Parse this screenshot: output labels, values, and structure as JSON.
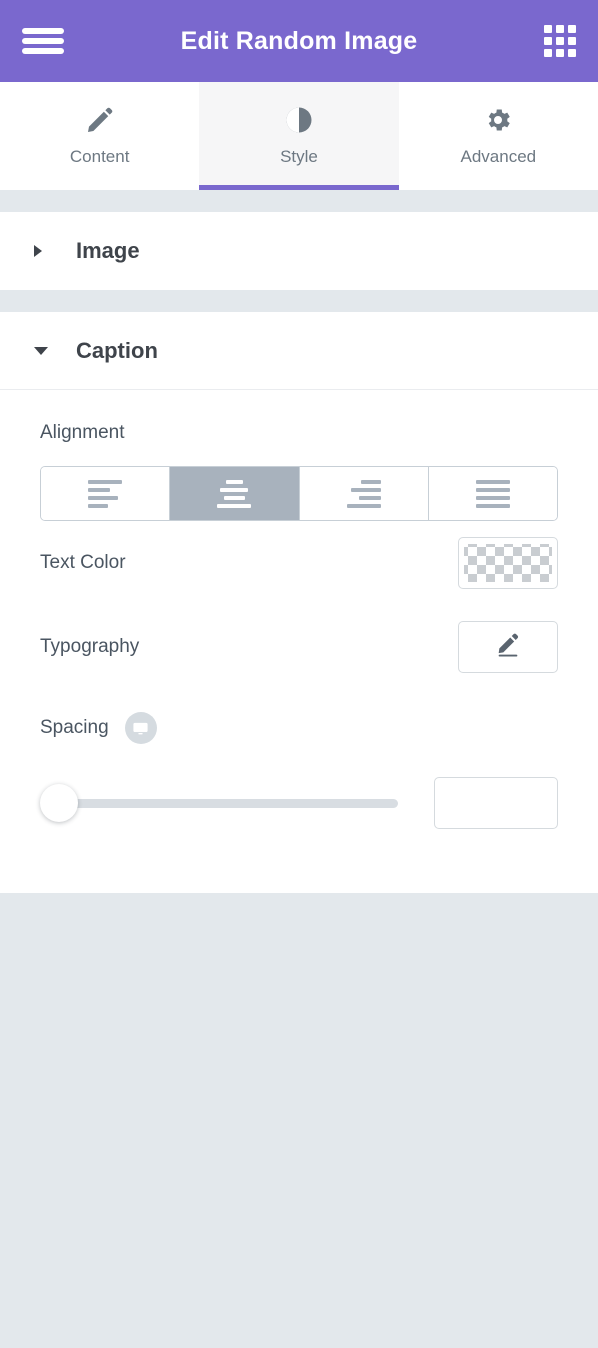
{
  "colors": {
    "header_purple": "#7a68ce",
    "panel_white": "#ffffff",
    "page_background": "#e3e8ec",
    "label_text": "#4a5561",
    "section_title": "#3f444b",
    "selected_choice": "#a8b2bd",
    "control_border": "#d5dade",
    "slider_track": "#d8dde2"
  },
  "header": {
    "title": "Edit Random Image",
    "menu_icon": "hamburger-menu-icon",
    "apps_icon": "apps-grid-icon"
  },
  "tabs": [
    {
      "label": "Content",
      "icon": "pencil-icon",
      "active": false
    },
    {
      "label": "Style",
      "icon": "contrast-icon",
      "active": true
    },
    {
      "label": "Advanced",
      "icon": "gear-icon",
      "active": false
    }
  ],
  "sections": [
    {
      "title": "Image",
      "expanded": false,
      "caret": "caret-right-icon"
    },
    {
      "title": "Caption",
      "expanded": true,
      "caret": "caret-down-icon"
    }
  ],
  "caption_controls": {
    "alignment": {
      "label": "Alignment",
      "selected": "center",
      "options": [
        {
          "value": "left",
          "icon": "align-left-icon"
        },
        {
          "value": "center",
          "icon": "align-center-icon"
        },
        {
          "value": "right",
          "icon": "align-right-icon"
        },
        {
          "value": "justify",
          "icon": "align-justify-icon"
        }
      ]
    },
    "text_color": {
      "label": "Text Color",
      "value": "transparent",
      "swatch": "transparent-checkerboard"
    },
    "typography": {
      "label": "Typography",
      "icon": "pencil-edit-icon"
    },
    "spacing": {
      "label": "Spacing",
      "device_icon": "desktop-monitor-icon",
      "slider_value": 0,
      "slider_min": 0,
      "slider_max": 100,
      "input_value": "",
      "input_placeholder": ""
    }
  }
}
